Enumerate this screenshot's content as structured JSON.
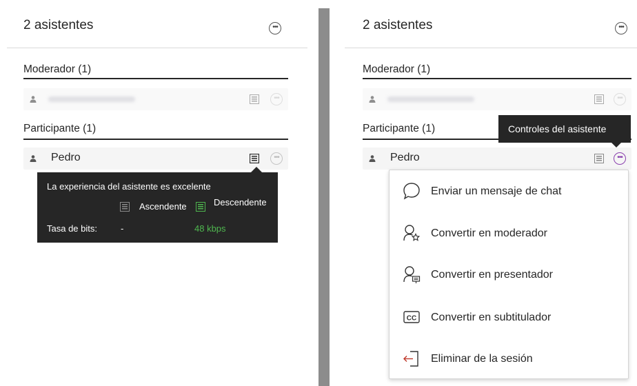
{
  "left_panel": {
    "title": "2 asistentes",
    "moderator_section": "Moderador (1)",
    "participant_section": "Participante (1)",
    "participant_name": "Pedro",
    "tooltip": {
      "line1": "La experiencia del asistente es excelente",
      "ascending_label": "Ascendente",
      "descending_label": "Descendente",
      "bitrate_label": "Tasa de bits:",
      "bitrate_up": "-",
      "bitrate_down": "48 kbps"
    }
  },
  "right_panel": {
    "title": "2 asistentes",
    "moderator_section": "Moderador (1)",
    "participant_section": "Participante (1)",
    "participant_name": "Pedro",
    "tooltip": "Controles del asistente",
    "menu": [
      {
        "label": "Enviar un mensaje de chat",
        "icon": "chat-bubble-icon"
      },
      {
        "label": "Convertir en moderador",
        "icon": "user-star-icon"
      },
      {
        "label": "Convertir en presentador",
        "icon": "user-presenter-icon"
      },
      {
        "label": "Convertir en subtitulador",
        "icon": "closed-caption-icon"
      },
      {
        "label": "Eliminar de la sesión",
        "icon": "exit-session-icon"
      }
    ]
  },
  "colors": {
    "accent": "#8a3fae",
    "good_signal": "#4fb84f",
    "remove_red": "#c0392b",
    "tooltip_bg": "#262626"
  }
}
